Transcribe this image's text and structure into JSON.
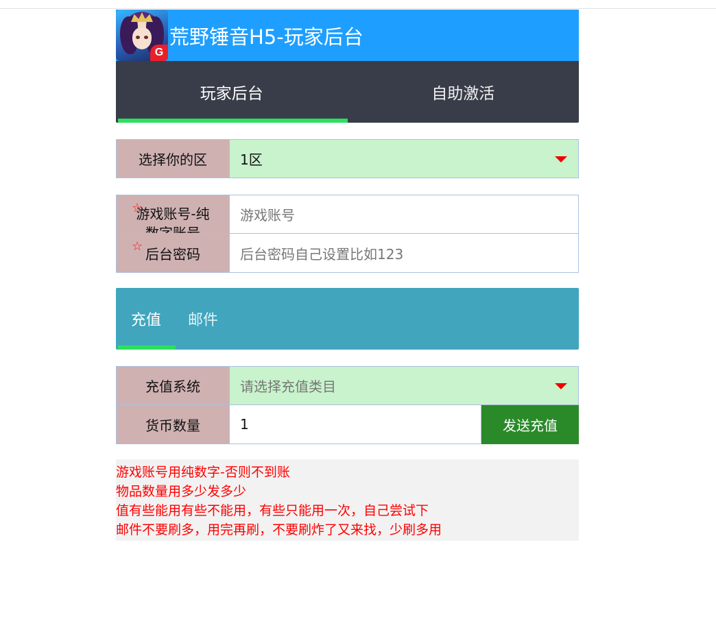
{
  "header": {
    "title": "荒野锤音H5-玩家后台",
    "logo_badge": "G",
    "logo_icon": "game-avatar-logo"
  },
  "main_tabs": [
    {
      "label": "玩家后台",
      "active": true
    },
    {
      "label": "自助激活",
      "active": false
    }
  ],
  "accent_colors": {
    "header": "#1e9fff",
    "tabs_bg": "#393d49",
    "active_underline": "#2be05c",
    "sub_tabs_bg": "#41a5be",
    "send_button": "#2a8a2a",
    "notice_text": "#ff0000"
  },
  "form": {
    "server": {
      "label": "选择你的区",
      "value": "1区"
    },
    "account": {
      "required_mark": "☆",
      "label": "游戏账号-纯数字账号",
      "placeholder": "游戏账号"
    },
    "password": {
      "required_mark": "☆",
      "label": "后台密码",
      "placeholder": "后台密码自己设置比如123"
    }
  },
  "sub_tabs": [
    {
      "label": "充值",
      "active": true
    },
    {
      "label": "邮件",
      "active": false
    }
  ],
  "recharge": {
    "system": {
      "label": "充值系统",
      "placeholder": "请选择充值类目"
    },
    "amount": {
      "label": "货币数量",
      "value": "1"
    },
    "send_label": "发送充值"
  },
  "notes": [
    "游戏账号用纯数字-否则不到账",
    "物品数量用多少发多少",
    "值有些能用有些不能用，有些只能用一次，自己尝试下",
    "邮件不要刷多，用完再刷，不要刷炸了又来找，少刷多用"
  ]
}
